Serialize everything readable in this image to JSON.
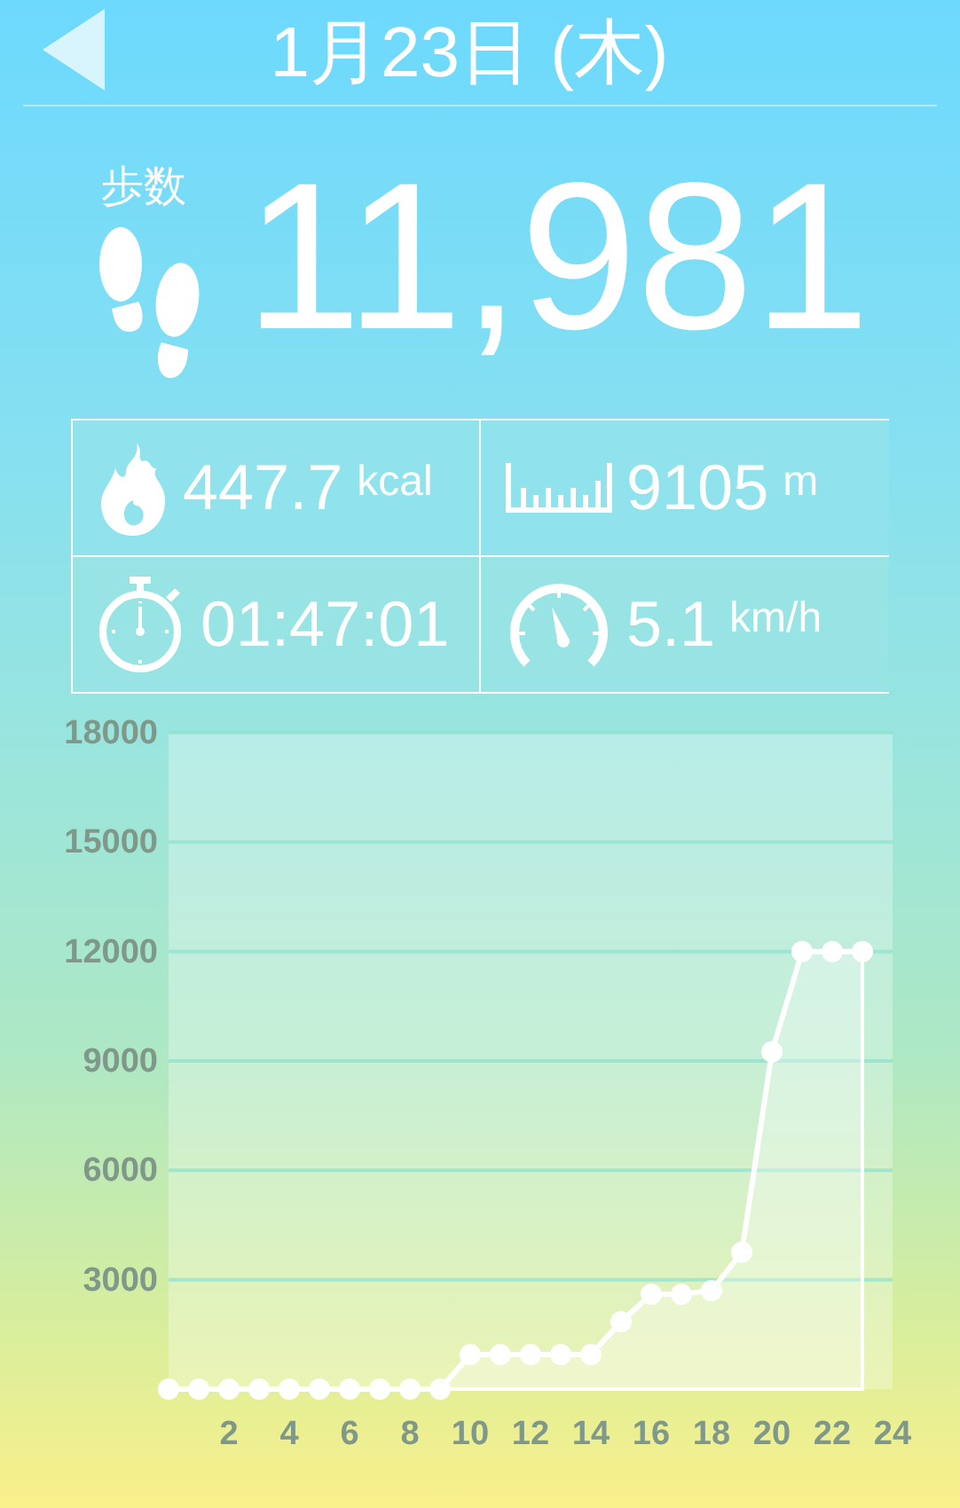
{
  "header": {
    "title": "1月23日 (木)"
  },
  "steps": {
    "label": "歩数",
    "value": "11,981"
  },
  "stats": [
    {
      "kind": "calories",
      "value": "447.7",
      "unit": "kcal"
    },
    {
      "kind": "distance",
      "value": "9105",
      "unit": "m"
    },
    {
      "kind": "time",
      "value": "01:47:01"
    },
    {
      "kind": "speed",
      "value": "5.1",
      "unit": "km/h"
    }
  ],
  "chart_data": {
    "type": "area",
    "x": [
      0,
      1,
      2,
      3,
      4,
      5,
      6,
      7,
      8,
      9,
      10,
      11,
      12,
      13,
      14,
      15,
      16,
      17,
      18,
      19,
      20,
      21,
      22,
      23
    ],
    "series": [
      {
        "color": "#ffffff",
        "values": [
          0,
          0,
          0,
          0,
          0,
          0,
          0,
          0,
          0,
          0,
          950,
          950,
          950,
          950,
          950,
          1850,
          2600,
          2600,
          2700,
          3750,
          9250,
          12000,
          12000,
          12000
        ]
      }
    ],
    "grid": true,
    "xlim": [
      0,
      24
    ],
    "ylim": [
      0,
      18000
    ],
    "xticks": [
      2,
      4,
      6,
      8,
      10,
      12,
      14,
      16,
      18,
      20,
      22,
      24
    ],
    "yticks": [
      3000,
      6000,
      9000,
      12000,
      15000,
      18000
    ]
  }
}
